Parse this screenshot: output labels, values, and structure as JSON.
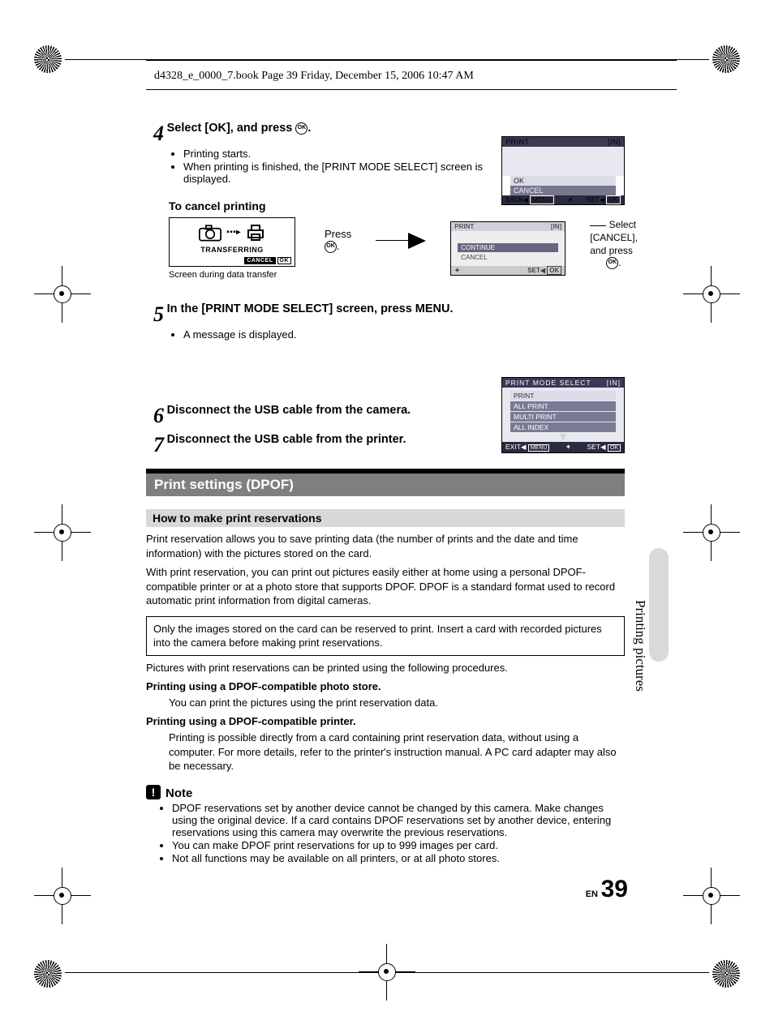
{
  "header": "d4328_e_0000_7.book  Page 39  Friday, December 15, 2006  10:47 AM",
  "step4": {
    "num": "4",
    "title_a": "Select [OK], and press ",
    "title_b": ".",
    "bullets": [
      "Printing starts.",
      "When printing is finished, the [PRINT MODE SELECT] screen is displayed."
    ]
  },
  "lcd_print": {
    "title": "PRINT",
    "in": "[IN]",
    "ok": "OK",
    "cancel": "CANCEL",
    "back": "BACK",
    "menu": "MENU",
    "set": "SET",
    "okbtn": "OK"
  },
  "cancel_heading": "To cancel printing",
  "transfer": {
    "label": "TRANSFERRING",
    "cancel": "CANCEL",
    "ok": "OK",
    "press": "Press ",
    "caption": "Screen during data transfer"
  },
  "lcd_cont": {
    "title": "PRINT",
    "in": "[IN]",
    "continue": "CONTINUE",
    "cancel": "CANCEL",
    "set": "SET",
    "ok": "OK"
  },
  "cancel_instr_a": "Select [CANCEL], and press ",
  "cancel_instr_b": ".",
  "step5": {
    "num": "5",
    "title_a": "In the [PRINT MODE SELECT] screen, press ",
    "menu": "MENU",
    "title_b": ".",
    "bullet": "A message is displayed."
  },
  "lcd_pms": {
    "title": "PRINT MODE SELECT",
    "in": "[IN]",
    "opts": [
      "PRINT",
      "ALL PRINT",
      "MULTI PRINT",
      "ALL INDEX"
    ],
    "exit": "EXIT",
    "menu": "MENU",
    "set": "SET",
    "ok": "OK"
  },
  "step6": {
    "num": "6",
    "title": "Disconnect the USB cable from the camera."
  },
  "step7": {
    "num": "7",
    "title": "Disconnect the USB cable from the printer."
  },
  "section": "Print settings (DPOF)",
  "subsection": "How to make print reservations",
  "para1": "Print reservation allows you to save printing data (the number of prints and the date and time information) with the pictures stored on the card.",
  "para2": "With print reservation, you can print out pictures easily either at home using a personal DPOF-compatible printer or at a photo store that supports DPOF. DPOF is a standard format used to record automatic print information from digital cameras.",
  "box": "Only the images stored on the card can be reserved to print. Insert a card with recorded pictures into the camera before making print reservations.",
  "para3": "Pictures with print reservations can be printed using the following procedures.",
  "proc1_title": "Printing using a DPOF-compatible photo store.",
  "proc1_body": "You can print the pictures using the print reservation data.",
  "proc2_title": "Printing using a DPOF-compatible printer.",
  "proc2_body": "Printing is possible directly from a card containing print reservation data, without using a computer. For more details, refer to the printer's instruction manual. A PC card adapter may also be necessary.",
  "note_label": "Note",
  "notes": [
    "DPOF reservations set by another device cannot be changed by this camera. Make changes using the original device. If a card contains DPOF reservations set by another device, entering reservations using this camera may overwrite the previous reservations.",
    "You can make DPOF print reservations for up to 999 images per card.",
    "Not all functions may be available on all printers, or at all photo stores."
  ],
  "side": "Printing pictures",
  "page_en": "EN",
  "page_num": "39"
}
